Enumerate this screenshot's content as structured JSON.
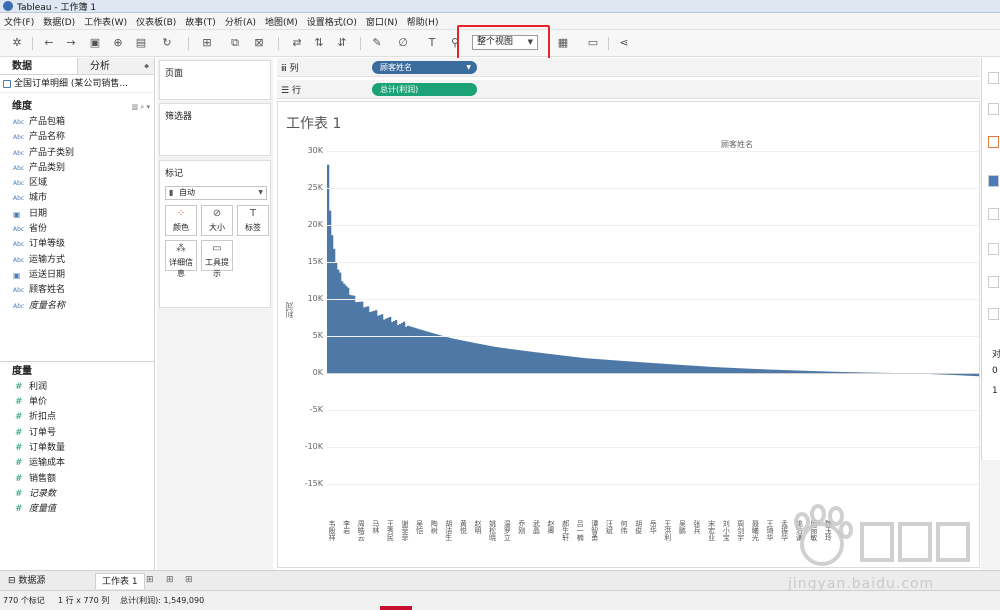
{
  "window": {
    "title": "Tableau - 工作簿 1"
  },
  "menu": [
    "文件(F)",
    "数据(D)",
    "工作表(W)",
    "仪表板(B)",
    "故事(T)",
    "分析(A)",
    "地图(M)",
    "设置格式(O)",
    "窗口(N)",
    "帮助(H)"
  ],
  "toolbar": {
    "fit_label": "整个视图"
  },
  "data_pane": {
    "tabs": [
      "数据",
      "分析"
    ],
    "datasource": "全国订单明细 (某公司销售...",
    "dimensions_label": "维度",
    "dimensions": [
      {
        "label": "产品包箱",
        "type": "Abc"
      },
      {
        "label": "产品名称",
        "type": "Abc"
      },
      {
        "label": "产品子类别",
        "type": "Abc"
      },
      {
        "label": "产品类别",
        "type": "Abc"
      },
      {
        "label": "区域",
        "type": "Abc"
      },
      {
        "label": "城市",
        "type": "Abc"
      },
      {
        "label": "日期",
        "type": "date"
      },
      {
        "label": "省份",
        "type": "Abc"
      },
      {
        "label": "订单等级",
        "type": "Abc"
      },
      {
        "label": "运输方式",
        "type": "Abc"
      },
      {
        "label": "运送日期",
        "type": "date"
      },
      {
        "label": "顾客姓名",
        "type": "Abc"
      },
      {
        "label": "度量名称",
        "type": "Abc",
        "italic": true
      }
    ],
    "measures_label": "度量",
    "measures": [
      {
        "label": "利润"
      },
      {
        "label": "单价"
      },
      {
        "label": "折扣点"
      },
      {
        "label": "订单号"
      },
      {
        "label": "订单数量"
      },
      {
        "label": "运输成本"
      },
      {
        "label": "销售额"
      },
      {
        "label": "记录数",
        "italic": true
      },
      {
        "label": "度量值",
        "italic": true
      }
    ]
  },
  "cards": {
    "pages": "页面",
    "filters": "筛选器",
    "marks": "标记",
    "marks_type": "自动",
    "mark_buttons": [
      "颜色",
      "大小",
      "标签",
      "详细信息",
      "工具提示"
    ]
  },
  "shelves": {
    "columns_label": "列",
    "rows_label": "行",
    "columns_pill": "顾客姓名",
    "rows_pill": "总计(利润)"
  },
  "sheet": {
    "title": "工作表 1",
    "column_header": "顾客姓名",
    "y_axis_title": "利润",
    "y_ticks": [
      "30K",
      "25K",
      "20K",
      "15K",
      "10K",
      "5K",
      "0K",
      "-5K",
      "-10K",
      "-15K"
    ]
  },
  "chart_data": {
    "type": "bar",
    "title": "工作表 1",
    "xlabel": "顾客姓名",
    "ylabel": "利润",
    "ylim": [
      -20000,
      30000
    ],
    "categories_visible": [
      "韦殷祥",
      "李岩",
      "周皓云",
      "马林",
      "王秀民",
      "谢菲菲",
      "吴恺",
      "陶树",
      "胡洁生",
      "黄悦",
      "赵明",
      "姚松晓",
      "温罗立",
      "乔刚",
      "武晶",
      "赵卿",
      "郝生轩",
      "吕一楠",
      "谭智勇",
      "汪斌",
      "何伟",
      "胡俊",
      "岳华",
      "王洪利",
      "吴鹏",
      "张兵",
      "宋宏业",
      "刘小宝",
      "周剑宇",
      "聂曦光",
      "王琦华",
      "孟振华",
      "姚浩谦",
      "邱丽敏",
      "魏玉玲"
    ],
    "series": [
      {
        "values_sampled_descending": [
          28500,
          26000,
          20000,
          16500,
          14000,
          12500,
          11000,
          10000,
          9200,
          8500,
          7800,
          7200,
          6700,
          6200,
          5700,
          5200,
          4700,
          4300,
          3900,
          3500,
          3200,
          2900,
          2600,
          2300,
          2000,
          1800,
          1600,
          1400,
          1200,
          1000,
          800,
          650,
          500,
          380,
          260,
          150,
          60,
          0,
          -100,
          -250,
          -450
        ]
      }
    ],
    "mark_count": 770,
    "bar_color": "#4e79a7"
  },
  "sheet_tabs": {
    "datasource": "数据源",
    "worksheet": "工作表 1"
  },
  "status": {
    "marks": "770 个标记",
    "rows_cols": "1 行 x 770 列",
    "total": "总计(利润): 1,549,090"
  },
  "right_pane": {
    "line1": "对",
    "line2": "0",
    "line3": "1"
  },
  "watermark": {
    "text": "jingyan.baidu.com"
  }
}
